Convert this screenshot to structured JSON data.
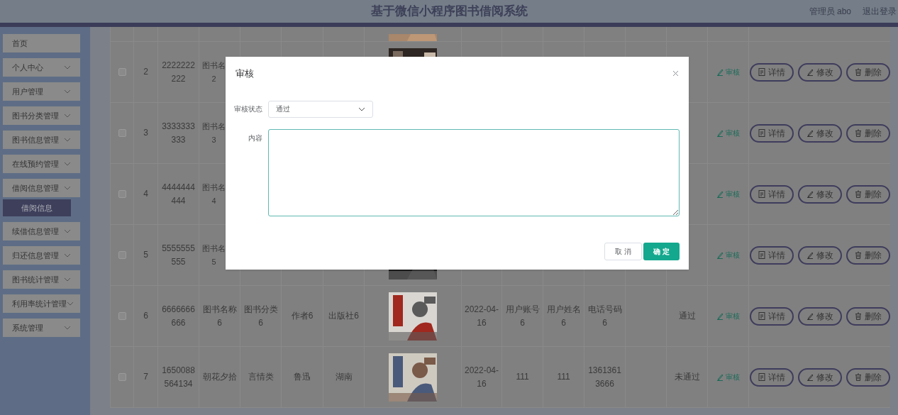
{
  "header": {
    "title": "基于微信小程序图书借阅系统",
    "user": "管理员 abo",
    "logout": "退出登录"
  },
  "sidebar": {
    "items": [
      {
        "label": "首页",
        "has_arrow": false
      },
      {
        "label": "个人中心",
        "has_arrow": true
      },
      {
        "label": "用户管理",
        "has_arrow": true
      },
      {
        "label": "图书分类管理",
        "has_arrow": true
      },
      {
        "label": "图书信息管理",
        "has_arrow": true
      },
      {
        "label": "在线预约管理",
        "has_arrow": true
      },
      {
        "label": "借阅信息管理",
        "has_arrow": true,
        "children": [
          {
            "label": "借阅信息",
            "selected": true
          }
        ]
      },
      {
        "label": "续借信息管理",
        "has_arrow": true
      },
      {
        "label": "归还信息管理",
        "has_arrow": true
      },
      {
        "label": "图书统计管理",
        "has_arrow": true
      },
      {
        "label": "利用率统计管理",
        "has_arrow": true
      },
      {
        "label": "系统管理",
        "has_arrow": true
      }
    ]
  },
  "table": {
    "rows": [
      {
        "kind": "partial"
      },
      {
        "kind": "covered",
        "checked": false,
        "index": "2",
        "account": "2222222222",
        "cover": {
          "kind": "picture"
        },
        "name_lines": [
          "图书名",
          "2"
        ],
        "audit": "审核",
        "actions": [
          "详情",
          "修改",
          "删除"
        ]
      },
      {
        "kind": "covered",
        "checked": false,
        "index": "3",
        "account": "3333333333",
        "name_lines": [
          "图书名",
          "3"
        ],
        "audit": "审核",
        "actions": [
          "详情",
          "修改",
          "删除"
        ]
      },
      {
        "kind": "covered",
        "checked": false,
        "index": "4",
        "account": "4444444444",
        "name_lines": [
          "图书名",
          "4"
        ],
        "audit": "审核",
        "actions": [
          "详情",
          "修改",
          "删除"
        ]
      },
      {
        "kind": "covered",
        "checked": false,
        "index": "5",
        "account": "5555555555",
        "cover": {
          "kind": "picture"
        },
        "name_lines": [
          "图书名",
          "5"
        ],
        "audit": "审核",
        "actions": [
          "详情",
          "修改",
          "删除"
        ]
      },
      {
        "kind": "full",
        "checked": false,
        "index": "6",
        "account": "6666666666",
        "name": "图书名称6",
        "category": "图书分类6",
        "author": "作者6",
        "publisher": "出版社6",
        "date": "2022-04-16",
        "user_account": "用户账号6",
        "user_name": "用户姓名6",
        "phone": "电话号码6",
        "status": "通过",
        "audit": "审核",
        "actions": [
          "详情",
          "修改",
          "删除"
        ]
      },
      {
        "kind": "full",
        "checked": false,
        "index": "7",
        "account": "1650088564134",
        "name": "朝花夕拾",
        "category": "言情类",
        "author": "鲁迅",
        "publisher": "湖南",
        "date": "2022-04-16",
        "user_account": "111",
        "user_name": "111",
        "phone": "13613613666",
        "status": "未通过",
        "audit": "审核",
        "actions": [
          "详情",
          "修改",
          "删除"
        ]
      }
    ]
  },
  "dialog": {
    "title": "审核",
    "fields": [
      {
        "kind": "select",
        "label": "审核状态",
        "value": "通过"
      },
      {
        "kind": "textarea",
        "label": "内容"
      }
    ],
    "buttons": [
      {
        "label": "取 消",
        "primary": false
      },
      {
        "label": "确 定",
        "primary": true
      }
    ]
  }
}
